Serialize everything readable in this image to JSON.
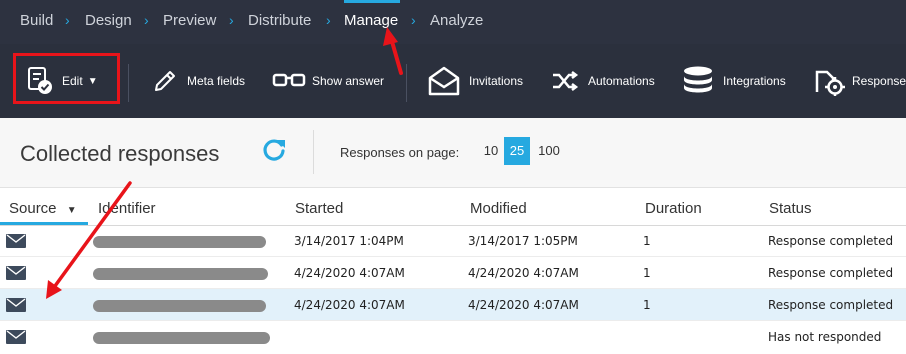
{
  "breadcrumb": [
    {
      "label": "Build",
      "active": false
    },
    {
      "label": "Design",
      "active": false
    },
    {
      "label": "Preview",
      "active": false
    },
    {
      "label": "Distribute",
      "active": false
    },
    {
      "label": "Manage",
      "active": true
    },
    {
      "label": "Analyze",
      "active": false
    }
  ],
  "toolbar": {
    "edit": "Edit",
    "meta_fields": "Meta fields",
    "show_answer": "Show answer",
    "invitations": "Invitations",
    "automations": "Automations",
    "integrations": "Integrations",
    "responses": "Response"
  },
  "page": {
    "title": "Collected responses",
    "responses_on_page_label": "Responses on page:",
    "page_size_options": [
      "10",
      "25",
      "100"
    ],
    "page_size_selected": "25"
  },
  "table": {
    "columns": {
      "source": "Source",
      "identifier": "Identifier",
      "started": "Started",
      "modified": "Modified",
      "duration": "Duration",
      "status": "Status"
    },
    "rows": [
      {
        "source": "email",
        "started": "3/14/2017 1:04PM",
        "modified": "3/14/2017 1:05PM",
        "duration": "1",
        "status": "Response completed",
        "selected": false
      },
      {
        "source": "email",
        "started": "4/24/2020 4:07AM",
        "modified": "4/24/2020 4:07AM",
        "duration": "1",
        "status": "Response completed",
        "selected": false
      },
      {
        "source": "email",
        "started": "4/24/2020 4:07AM",
        "modified": "4/24/2020 4:07AM",
        "duration": "1",
        "status": "Response completed",
        "selected": true
      },
      {
        "source": "email",
        "started": "",
        "modified": "",
        "duration": "",
        "status": "Has not responded",
        "selected": false
      }
    ]
  },
  "colors": {
    "nav_bg": "#2d3240",
    "toolbar_bg": "#2b303d",
    "accent": "#26a9e0",
    "annotation": "#e8141a",
    "selected_row": "#e2f1fa"
  }
}
